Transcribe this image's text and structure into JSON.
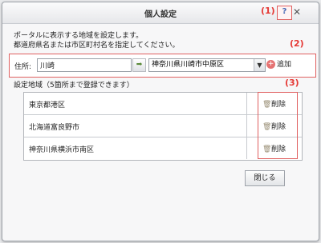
{
  "window": {
    "title": "個人設定",
    "help_glyph": "?",
    "close_glyph": "✕"
  },
  "callouts": [
    "(1)",
    "(2)",
    "(3)"
  ],
  "description": [
    "ポータルに表示する地域を設定します。",
    "都道府県名または市区町村名を指定してください。"
  ],
  "search": {
    "label": "住所:",
    "input_value": "川崎",
    "arrow_glyph": "➡",
    "selected_city": "神奈川県川崎市中原区",
    "dropdown_glyph": "▼",
    "add_label": "追加",
    "add_glyph": "+"
  },
  "list": {
    "label": "設定地域（5箇所まで登録できます）",
    "delete_label": "削除",
    "items": [
      {
        "name": "東京都港区"
      },
      {
        "name": "北海道富良野市"
      },
      {
        "name": "神奈川県横浜市南区"
      }
    ]
  },
  "close_button": "閉じる"
}
